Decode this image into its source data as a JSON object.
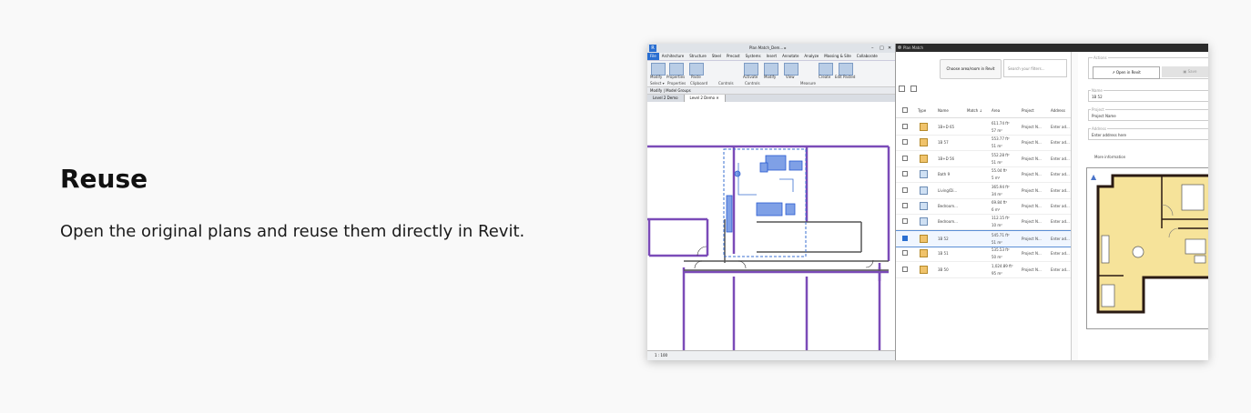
{
  "hero": {
    "title": "Reuse",
    "description": "Open the original plans and reuse them directly in Revit."
  },
  "revit": {
    "app_logo": "R",
    "document_title": "Plan Match_Dem... ▸",
    "menu": [
      "File",
      "Architecture",
      "Structure",
      "Steel",
      "Precast",
      "Systems",
      "Insert",
      "Annotate",
      "Analyze",
      "Massing & Site",
      "Collaborate",
      "►"
    ],
    "ribbon_buttons": [
      {
        "label": "Modify"
      },
      {
        "label": "Properties"
      },
      {
        "label": "Paste"
      },
      {
        "label": "Clipboard"
      },
      {
        "label": "Geometry"
      },
      {
        "label": "Activate"
      },
      {
        "label": "Modify"
      },
      {
        "label": "View"
      },
      {
        "label": "Create"
      },
      {
        "label": "Edit Pasted"
      }
    ],
    "ribbon_groups": [
      "Select ▾",
      "Properties",
      "Clipboard",
      "Geometry",
      "Controls",
      "Measure"
    ],
    "context_bar": "Modify | Model Groups",
    "view_tabs": [
      "Level 2 Demo",
      "Level 2 Demo ✕"
    ],
    "status": "1 : 100"
  },
  "plan_match": {
    "title": "Plan Match",
    "choose_button": "Choose area/room in Revit",
    "search_placeholder": "Search your filters...",
    "columns": [
      "Type",
      "Name",
      "Match ↓",
      "Area",
      "Project",
      "Address"
    ],
    "rows": [
      {
        "type": "unit",
        "name": "1B+D 65",
        "area1": "611.74 ft²",
        "area2": "57 m²",
        "project": "Project N...",
        "address": "Enter ad...",
        "checked": false
      },
      {
        "type": "unit",
        "name": "1B 57",
        "area1": "553.77 ft²",
        "area2": "51 m²",
        "project": "Project N...",
        "address": "Enter ad...",
        "checked": false
      },
      {
        "type": "unit",
        "name": "1B+D 56",
        "area1": "552.28 ft²",
        "area2": "51 m²",
        "project": "Project N...",
        "address": "Enter ad...",
        "checked": false
      },
      {
        "type": "room",
        "name": "Bath 9",
        "area1": "55.04 ft²",
        "area2": "5 m²",
        "project": "Project N...",
        "address": "Enter ad...",
        "checked": false
      },
      {
        "type": "room",
        "name": "Living/Di...",
        "area1": "365.94 ft²",
        "area2": "34 m²",
        "project": "Project N...",
        "address": "Enter ad...",
        "checked": false
      },
      {
        "type": "room",
        "name": "Bedroom...",
        "area1": "69.84 ft²",
        "area2": "6 m²",
        "project": "Project N...",
        "address": "Enter ad...",
        "checked": false
      },
      {
        "type": "room",
        "name": "Bedroom...",
        "area1": "112.15 ft²",
        "area2": "10 m²",
        "project": "Project N...",
        "address": "Enter ad...",
        "checked": false
      },
      {
        "type": "unit",
        "name": "1B 52",
        "area1": "545.71 ft²",
        "area2": "51 m²",
        "project": "Project N...",
        "address": "Enter ad...",
        "checked": true
      },
      {
        "type": "unit",
        "name": "1B 51",
        "area1": "535.53 ft²",
        "area2": "50 m²",
        "project": "Project N...",
        "address": "Enter ad...",
        "checked": false
      },
      {
        "type": "unit",
        "name": "3B 50",
        "area1": "1,024.89 ft²",
        "area2": "95 m²",
        "project": "Project N...",
        "address": "Enter ad...",
        "checked": false
      }
    ],
    "detail": {
      "actions_label": "Actions",
      "open_button": "Open in Revit",
      "save_button": "Save",
      "name_label": "Name",
      "name_value": "1B 52",
      "project_label": "Project",
      "project_value": "Project Name",
      "address_label": "Address",
      "address_value": "Enter address here",
      "more_info": "More information"
    },
    "colors": {
      "unit": "#f0c36b",
      "room": "#cfe0f3",
      "accent": "#2a6fd1"
    }
  }
}
